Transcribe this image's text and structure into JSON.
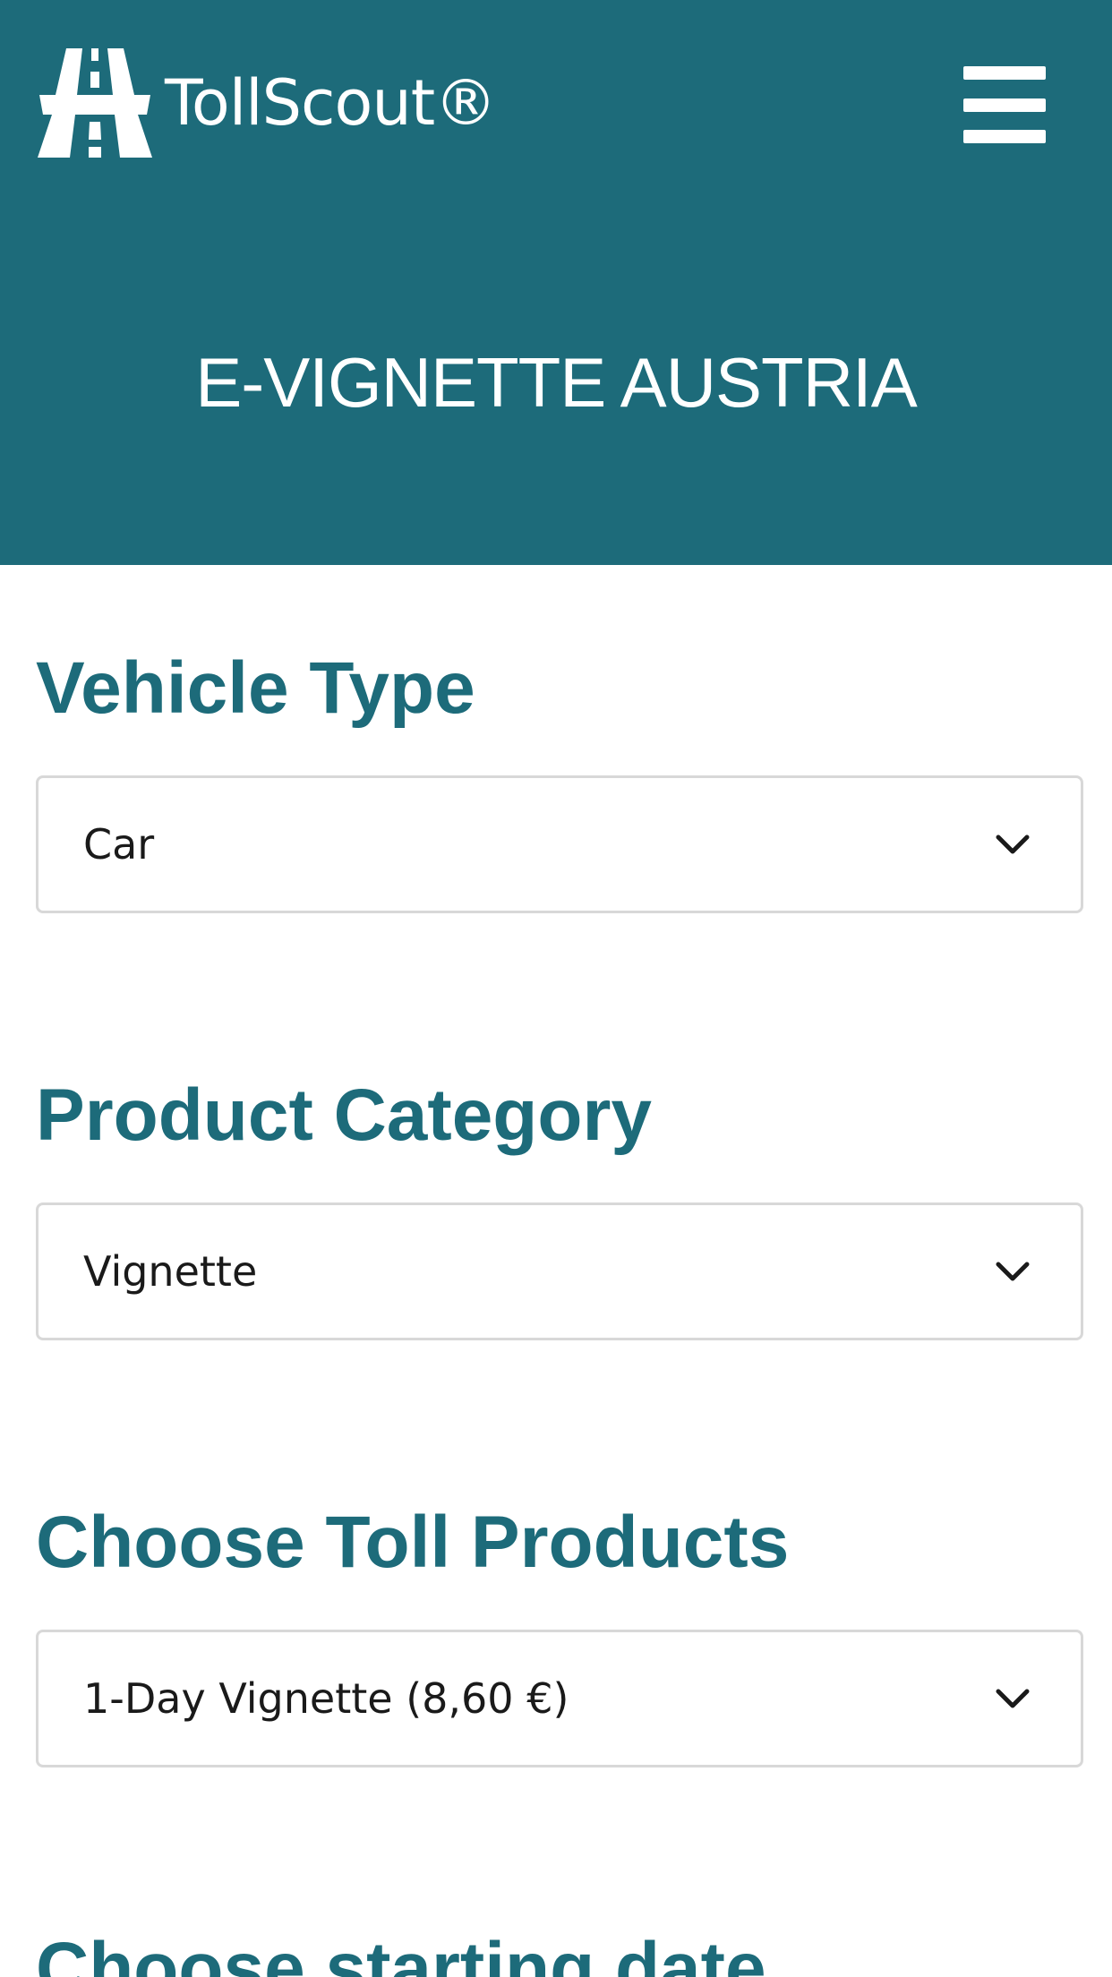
{
  "header": {
    "logo_text": "TollScout®",
    "menu_icon": "hamburger-menu-icon",
    "title": "E-VIGNETTE AUSTRIA",
    "background_color": "#1d6b7a"
  },
  "form": {
    "vehicle_type": {
      "label": "Vehicle Type",
      "selected": "Car"
    },
    "product_category": {
      "label": "Product Category",
      "selected": "Vignette"
    },
    "toll_products": {
      "label": "Choose Toll Products",
      "selected": "1-Day Vignette (8,60 €)"
    },
    "starting_date": {
      "label": "Choose starting date"
    }
  },
  "colors": {
    "accent": "#1d6b7a",
    "border": "#d8d8d8",
    "text": "#1a1a1a"
  }
}
